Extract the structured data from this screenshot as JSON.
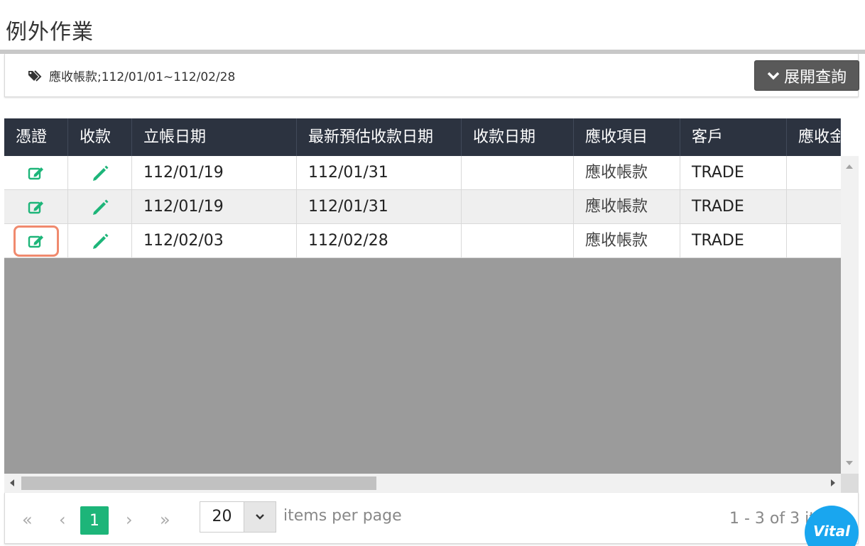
{
  "page": {
    "title": "例外作業"
  },
  "filter": {
    "tag_text": "應收帳款;112/01/01~112/02/28",
    "expand_label": "展開查詢"
  },
  "grid": {
    "columns": [
      "憑證",
      "收款",
      "立帳日期",
      "最新預估收款日期",
      "收款日期",
      "應收項目",
      "客戶",
      "應收金"
    ],
    "rows": [
      {
        "date": "112/01/19",
        "est_date": "112/01/31",
        "receive_date": "",
        "item": "應收帳款",
        "customer": "TRADE",
        "amount": ""
      },
      {
        "date": "112/01/19",
        "est_date": "112/01/31",
        "receive_date": "",
        "item": "應收帳款",
        "customer": "TRADE",
        "amount": ""
      },
      {
        "date": "112/02/03",
        "est_date": "112/02/28",
        "receive_date": "",
        "item": "應收帳款",
        "customer": "TRADE",
        "amount": ""
      }
    ]
  },
  "pager": {
    "first": "«",
    "prev": "‹",
    "current": "1",
    "next": "›",
    "last": "»",
    "page_size": "20",
    "per_page_label": "items per page",
    "summary": "1 - 3 of 3 it"
  },
  "badge": {
    "label": "Vital"
  },
  "colors": {
    "header_bg": "#2c3340",
    "accent_green": "#1db579",
    "highlight": "#f08a6e",
    "badge_blue": "#19a6ef"
  },
  "icons": {
    "tag": "tags-icon",
    "chevron": "chevron-down-icon",
    "voucher": "edit-square-icon",
    "receive": "pencil-icon"
  }
}
